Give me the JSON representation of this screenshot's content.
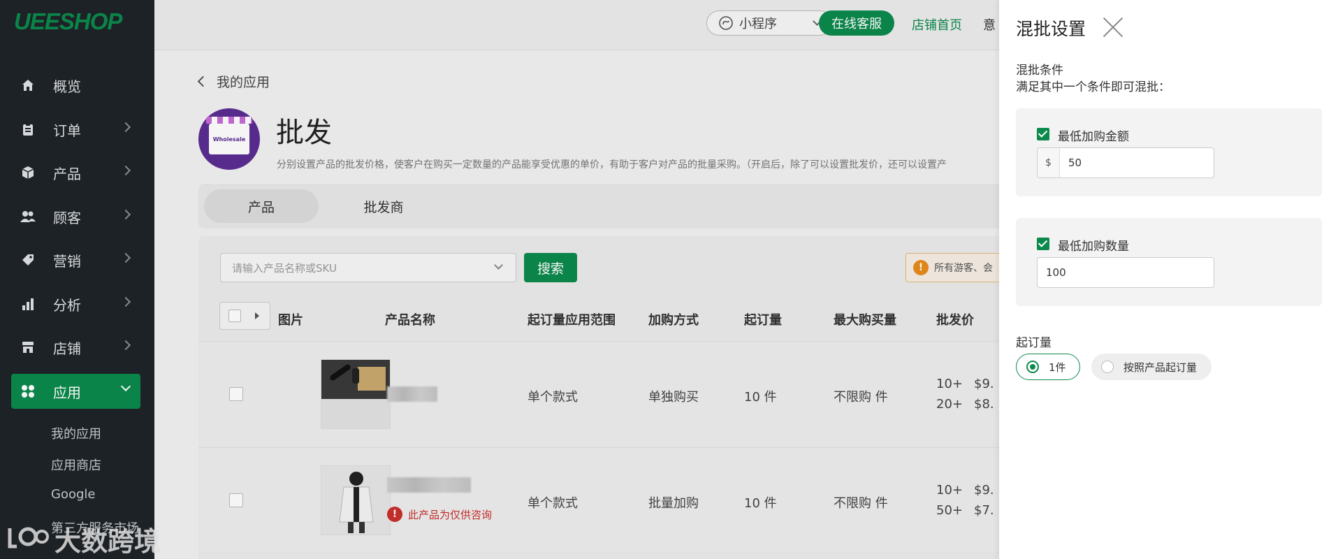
{
  "brand": {
    "logo": "UEESHOP"
  },
  "sidebar": {
    "items": [
      {
        "label": "概览",
        "icon": "home-icon",
        "has_chevron": false
      },
      {
        "label": "订单",
        "icon": "clipboard-icon",
        "has_chevron": true
      },
      {
        "label": "产品",
        "icon": "cube-icon",
        "has_chevron": true
      },
      {
        "label": "顾客",
        "icon": "users-icon",
        "has_chevron": true
      },
      {
        "label": "营销",
        "icon": "tag-icon",
        "has_chevron": true
      },
      {
        "label": "分析",
        "icon": "bar-chart-icon",
        "has_chevron": true
      },
      {
        "label": "店铺",
        "icon": "store-icon",
        "has_chevron": true
      },
      {
        "label": "应用",
        "icon": "apps-grid-icon",
        "has_chevron": true,
        "active": true
      }
    ],
    "sub_items": [
      "我的应用",
      "应用商店",
      "Google",
      "第三方服务市场"
    ]
  },
  "topbar": {
    "mini_program": "小程序",
    "online_service": "在线客服",
    "store_home": "店铺首页",
    "partial_link": "意"
  },
  "page": {
    "back_label": "我的应用",
    "app_title": "批发",
    "app_logo_text": "Wholesale",
    "description": "分别设置产品的批发价格，使客户在购买一定数量的产品能享受优惠的单价，有助于客户对产品的批量采购。（开启后，除了可以设置批发价，还可以设置产",
    "tabs": [
      "产品",
      "批发商"
    ],
    "search_placeholder": "请输入产品名称或SKU",
    "search_button": "搜索",
    "notice": "所有游客、会",
    "table": {
      "headers": [
        "图片",
        "产品名称",
        "起订量应用范围",
        "加购方式",
        "起订量",
        "最大购买量",
        "批发价"
      ],
      "rows": [
        {
          "scope": "单个款式",
          "method": "单独购买",
          "moq": "10 件",
          "max": "不限购 件",
          "tiers": [
            "10+",
            "20+"
          ],
          "prices": [
            "$9.",
            "$8."
          ],
          "notice": ""
        },
        {
          "scope": "单个款式",
          "method": "批量加购",
          "moq": "10 件",
          "max": "不限购 件",
          "tiers": [
            "10+",
            "50+"
          ],
          "prices": [
            "$9.",
            "$7."
          ],
          "notice": "此产品为仅供咨询"
        }
      ]
    }
  },
  "drawer": {
    "title": "混批设置",
    "condition_title": "混批条件",
    "condition_sub": "满足其中一个条件即可混批：",
    "min_amount": {
      "label": "最低加购金额",
      "prefix": "$",
      "value": "50",
      "checked": true
    },
    "min_qty": {
      "label": "最低加购数量",
      "value": "100",
      "checked": true
    },
    "moq_title": "起订量",
    "moq_options": [
      {
        "label": "1件",
        "selected": true
      },
      {
        "label": "按照产品起订量",
        "selected": false
      }
    ]
  },
  "watermark": {
    "text": "大数跨境"
  },
  "colors": {
    "accent": "#0c8a4d",
    "sidebar_bg": "#1f2428",
    "danger": "#c9302c",
    "warning": "#e88b1c"
  }
}
